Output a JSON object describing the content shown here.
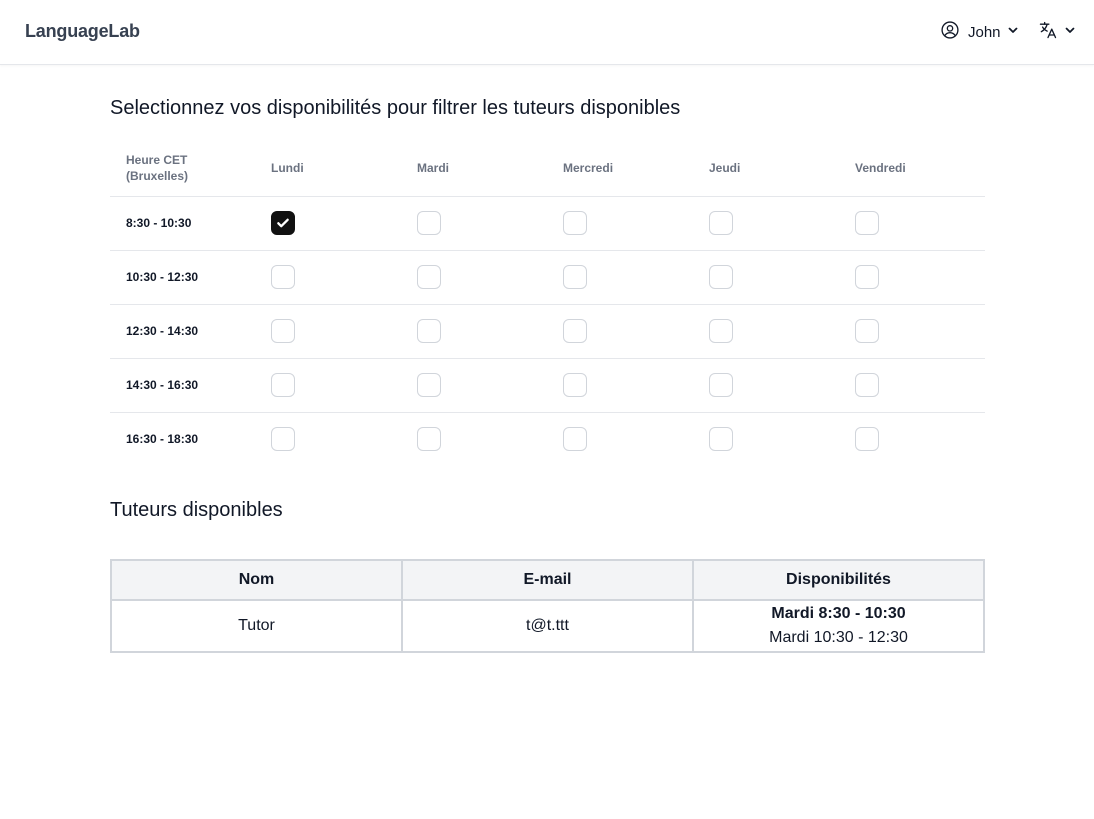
{
  "header": {
    "brand": "LanguageLab",
    "user_name": "John",
    "user_icon": "user-circle-icon",
    "lang_icon": "translate-icon"
  },
  "availability": {
    "title": "Selectionnez vos disponibilités pour filtrer les tuteurs disponibles",
    "time_header_line1": "Heure CET",
    "time_header_line2": "(Bruxelles)",
    "days": [
      "Lundi",
      "Mardi",
      "Mercredi",
      "Jeudi",
      "Vendredi"
    ],
    "slots": [
      "8:30 - 10:30",
      "10:30 - 12:30",
      "12:30 - 14:30",
      "14:30 - 16:30",
      "16:30 - 18:30"
    ],
    "checked": [
      [
        true,
        false,
        false,
        false,
        false
      ],
      [
        false,
        false,
        false,
        false,
        false
      ],
      [
        false,
        false,
        false,
        false,
        false
      ],
      [
        false,
        false,
        false,
        false,
        false
      ],
      [
        false,
        false,
        false,
        false,
        false
      ]
    ]
  },
  "tutors": {
    "title": "Tuteurs disponibles",
    "columns": [
      "Nom",
      "E-mail",
      "Disponibilités"
    ],
    "rows": [
      {
        "name": "Tutor",
        "email": "t@t.ttt",
        "availability_match": "Mardi 8:30 - 10:30",
        "availability_other": "Mardi 10:30 - 12:30"
      }
    ]
  },
  "colors": {
    "brand_text": "#374151",
    "checkbox_checked": "#111111",
    "table_header_bg": "#f3f4f6"
  }
}
